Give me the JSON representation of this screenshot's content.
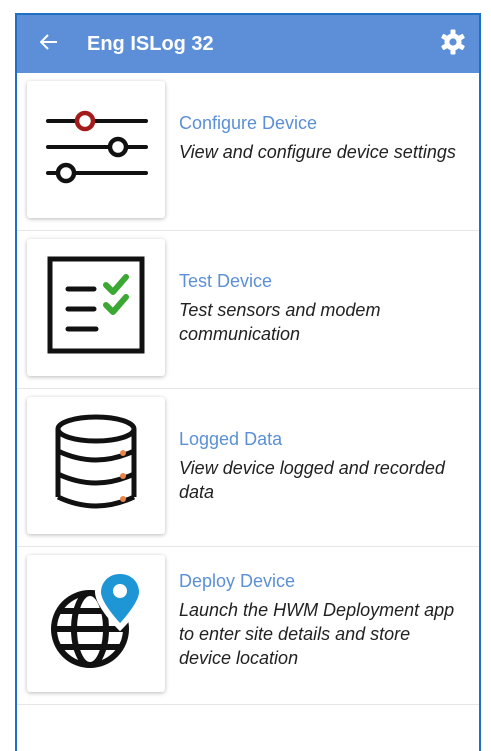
{
  "appbar": {
    "title": "Eng ISLog 32",
    "back_icon": "arrow-left-icon",
    "settings_icon": "gear-icon",
    "color": "#5c8fd8"
  },
  "menu": {
    "items": [
      {
        "title": "Configure Device",
        "description": "View and configure device settings",
        "icon": "sliders-icon"
      },
      {
        "title": "Test Device",
        "description": "Test sensors and modem communication",
        "icon": "checklist-icon"
      },
      {
        "title": "Logged Data",
        "description": "View device logged and recorded data",
        "icon": "database-icon"
      },
      {
        "title": "Deploy Device",
        "description": "Launch the HWM Deployment app to enter site details and store device location",
        "icon": "globe-location-pin-icon"
      }
    ]
  },
  "colors": {
    "accent": "#5c8fd8",
    "title_text": "#5b8fd6",
    "slider_knob": "#a31b1b",
    "check_green": "#3aa832",
    "db_dots": "#e8864a",
    "pin_blue": "#1e96d6"
  }
}
